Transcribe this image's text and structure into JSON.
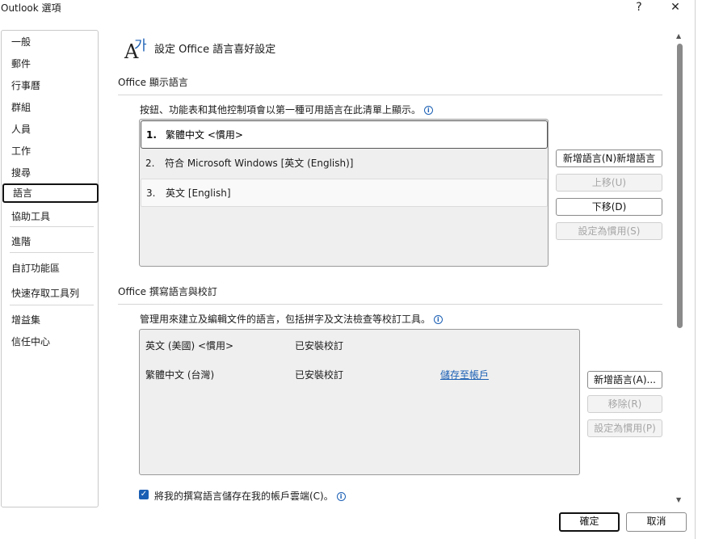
{
  "window": {
    "title": "Outlook 選項",
    "help_glyph": "?",
    "close_glyph": "✕"
  },
  "sidebar": {
    "items": [
      {
        "label": "一般"
      },
      {
        "label": "郵件"
      },
      {
        "label": "行事曆"
      },
      {
        "label": "群組"
      },
      {
        "label": "人員"
      },
      {
        "label": "工作"
      },
      {
        "label": "搜尋"
      },
      {
        "label": "語言",
        "selected": true
      },
      {
        "label": "協助工具"
      },
      {
        "label": "進階"
      },
      {
        "label": "自訂功能區"
      },
      {
        "label": "快速存取工具列"
      },
      {
        "label": "增益集"
      },
      {
        "label": "信任中心"
      }
    ]
  },
  "header": {
    "icon": "language-icon",
    "icon_glyph_a": "A",
    "icon_glyph_b": "가",
    "title": "設定 Office 語言喜好設定"
  },
  "display_section": {
    "title": "Office 顯示語言",
    "description": "按鈕、功能表和其他控制項會以第一種可用語言在此清單上顯示。",
    "languages": [
      {
        "index": "1.",
        "name": "繁體中文 <慣用>"
      },
      {
        "index": "2.",
        "name": "符合 Microsoft Windows [英文 (English)]"
      },
      {
        "index": "3.",
        "name": "英文 [English]"
      }
    ],
    "buttons": {
      "add": "新增語言(N)新增語言",
      "move_up": "上移(U)",
      "move_down": "下移(D)",
      "set_preferred": "設定為慣用(S)"
    }
  },
  "authoring_section": {
    "title": "Office 撰寫語言與校訂",
    "description": "管理用來建立及編輯文件的語言，包括拼字及文法檢查等校訂工具。",
    "languages": [
      {
        "name": "英文 (美國) <慣用>",
        "status": "已安裝校訂",
        "action": ""
      },
      {
        "name": "繁體中文 (台灣)",
        "status": "已安裝校訂",
        "action": "儲存至帳戶"
      }
    ],
    "buttons": {
      "add": "新增語言(A)...",
      "remove": "移除(R)",
      "set_preferred": "設定為慣用(P)"
    },
    "save_checkbox": {
      "label": "將我的撰寫語言儲存在我的帳戶雲端(C)。",
      "checked": true
    }
  },
  "footer": {
    "ok": "確定",
    "cancel": "取消"
  },
  "colors": {
    "accent": "#1a5fb4",
    "border": "#9a9a9a",
    "disabled_text": "#a6a6a6"
  }
}
